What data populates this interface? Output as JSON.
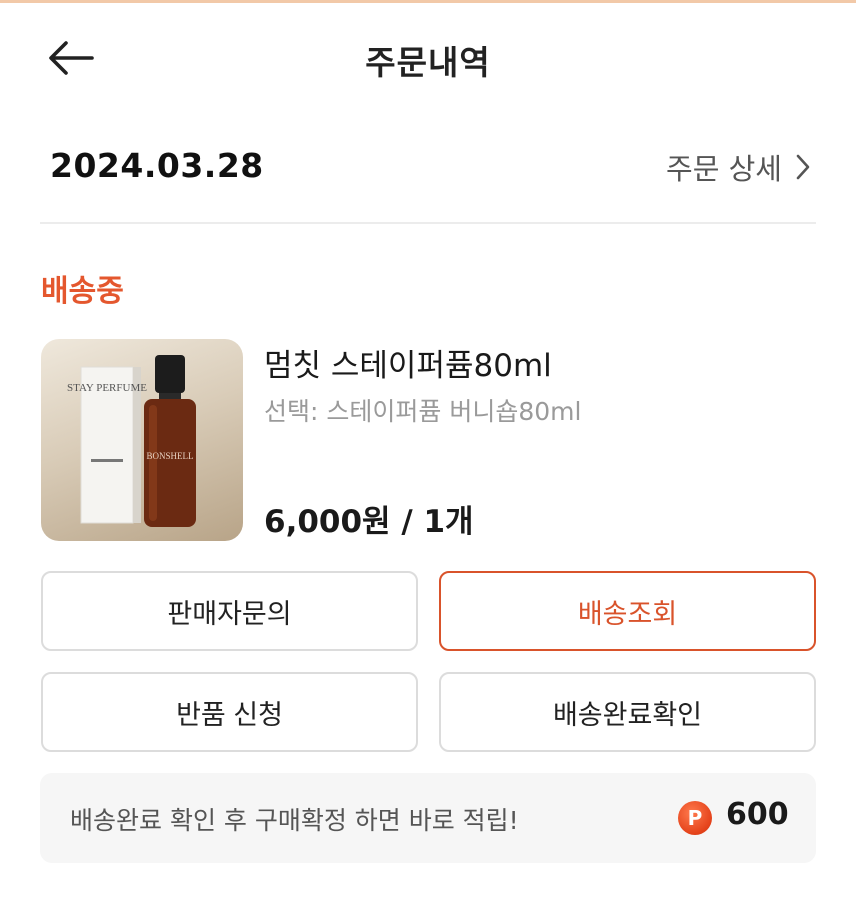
{
  "header": {
    "title": "주문내역",
    "back_icon": "arrow-left-icon"
  },
  "order": {
    "date": "2024.03.28",
    "detail_label": "주문 상세",
    "detail_icon": "chevron-right-icon"
  },
  "status": {
    "label": "배송중",
    "color": "#e4572e"
  },
  "product": {
    "name": "멈칫 스테이퍼퓸80ml",
    "option": "선택: 스테이퍼퓸 버니숍80ml",
    "price": "6,000원 / 1개",
    "image_label": "STAY PERFUME",
    "image_brand": "BONSHELL"
  },
  "actions": {
    "seller_inquiry": "판매자문의",
    "track_delivery": "배송조회",
    "return_request": "반품 신청",
    "confirm_delivery": "배송완료확인"
  },
  "points": {
    "message": "배송완료 확인 후 구매확정 하면 바로 적립!",
    "badge": "P",
    "value": "600"
  },
  "colors": {
    "accent": "#d9532b",
    "divider": "#ececec",
    "points_bar": "#f6f6f6"
  }
}
